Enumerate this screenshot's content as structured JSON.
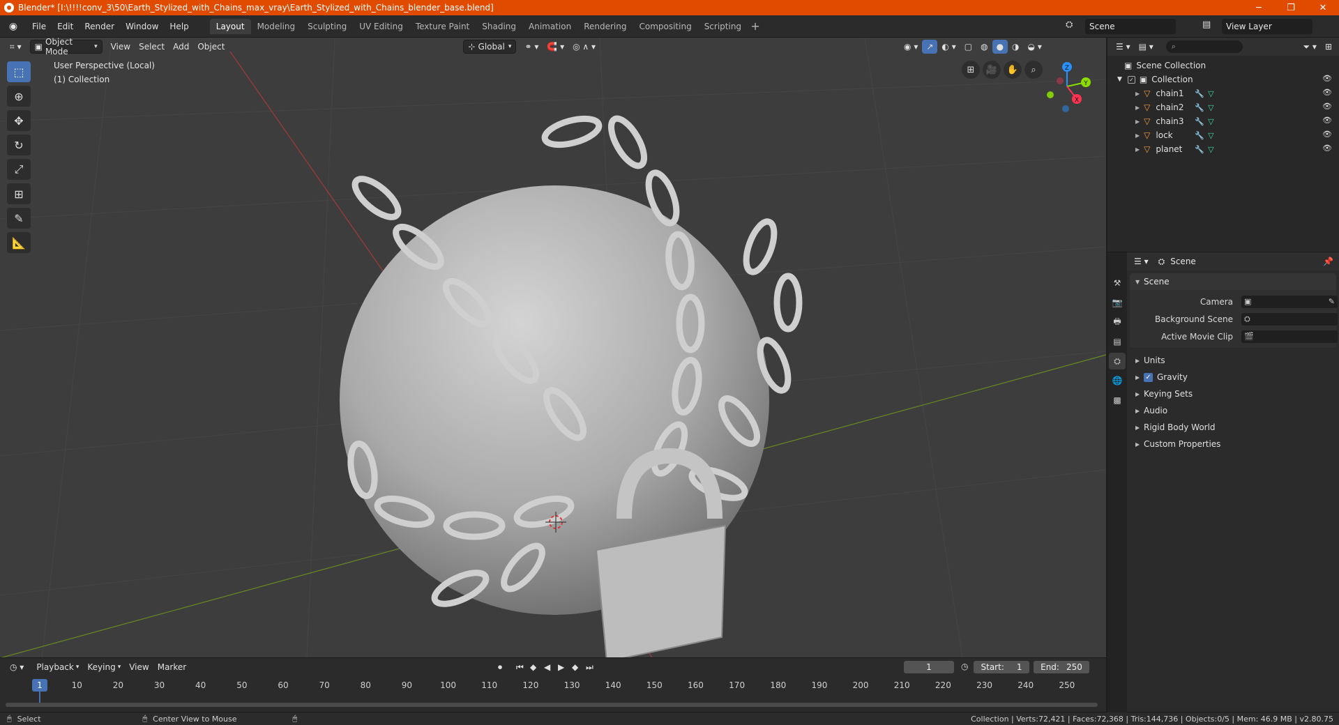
{
  "window": {
    "title": "Blender* [I:\\!!!!conv_3\\50\\Earth_Stylized_with_Chains_max_vray\\Earth_Stylized_with_Chains_blender_base.blend]",
    "minimize": "─",
    "maximize": "❐",
    "close": "✕"
  },
  "topbar": {
    "menus": [
      "File",
      "Edit",
      "Render",
      "Window",
      "Help"
    ],
    "workspaces": [
      "Layout",
      "Modeling",
      "Sculpting",
      "UV Editing",
      "Texture Paint",
      "Shading",
      "Animation",
      "Rendering",
      "Compositing",
      "Scripting"
    ],
    "active_workspace": "Layout",
    "add_workspace": "+",
    "scene_name": "Scene",
    "view_layer_name": "View Layer"
  },
  "viewport": {
    "mode": "Object Mode",
    "menus": [
      "View",
      "Select",
      "Add",
      "Object"
    ],
    "orientation": "Global",
    "info_line1": "User Perspective (Local)",
    "info_line2": "(1) Collection",
    "gizmo_axes": [
      "X",
      "Y",
      "Z"
    ],
    "icons": {
      "select": "select-box-icon",
      "cursor": "cursor-icon",
      "move": "move-icon",
      "rotate": "rotate-icon",
      "scale": "scale-icon",
      "transform": "transform-icon",
      "annotate": "annotate-icon",
      "measure": "measure-icon"
    }
  },
  "timeline": {
    "menus": [
      "Playback",
      "Keying",
      "View",
      "Marker"
    ],
    "current_frame": "1",
    "start_label": "Start:",
    "start_value": "1",
    "end_label": "End:",
    "end_value": "250",
    "ruler_labels": [
      "1",
      "10",
      "20",
      "30",
      "40",
      "50",
      "60",
      "70",
      "80",
      "90",
      "100",
      "110",
      "120",
      "130",
      "140",
      "150",
      "160",
      "170",
      "180",
      "190",
      "200",
      "210",
      "220",
      "230",
      "240",
      "250"
    ]
  },
  "statusbar": {
    "left_action": "Select",
    "middle_action": "Center View to Mouse",
    "stats": "Collection | Verts:72,421 | Faces:72,368 | Tris:144,736 | Objects:0/5 | Mem: 46.9 MB | v2.80.75"
  },
  "outliner": {
    "root": "Scene Collection",
    "collection": "Collection",
    "objects": [
      "chain1",
      "chain2",
      "chain3",
      "lock",
      "planet"
    ]
  },
  "properties": {
    "header": "Scene",
    "panel": "Scene",
    "camera_label": "Camera",
    "background_scene_label": "Background Scene",
    "active_movie_clip_label": "Active Movie Clip",
    "collapsed_panels": [
      "Units",
      "Gravity",
      "Keying Sets",
      "Audio",
      "Rigid Body World",
      "Custom Properties"
    ],
    "gravity_checked": true
  },
  "colors": {
    "title_bar": "#e14b00",
    "accent": "#4772b3",
    "viewport_bg": "#3d3d3d",
    "axis_x": "#ff3352",
    "axis_y": "#8bdc00",
    "axis_z": "#2890ff"
  }
}
